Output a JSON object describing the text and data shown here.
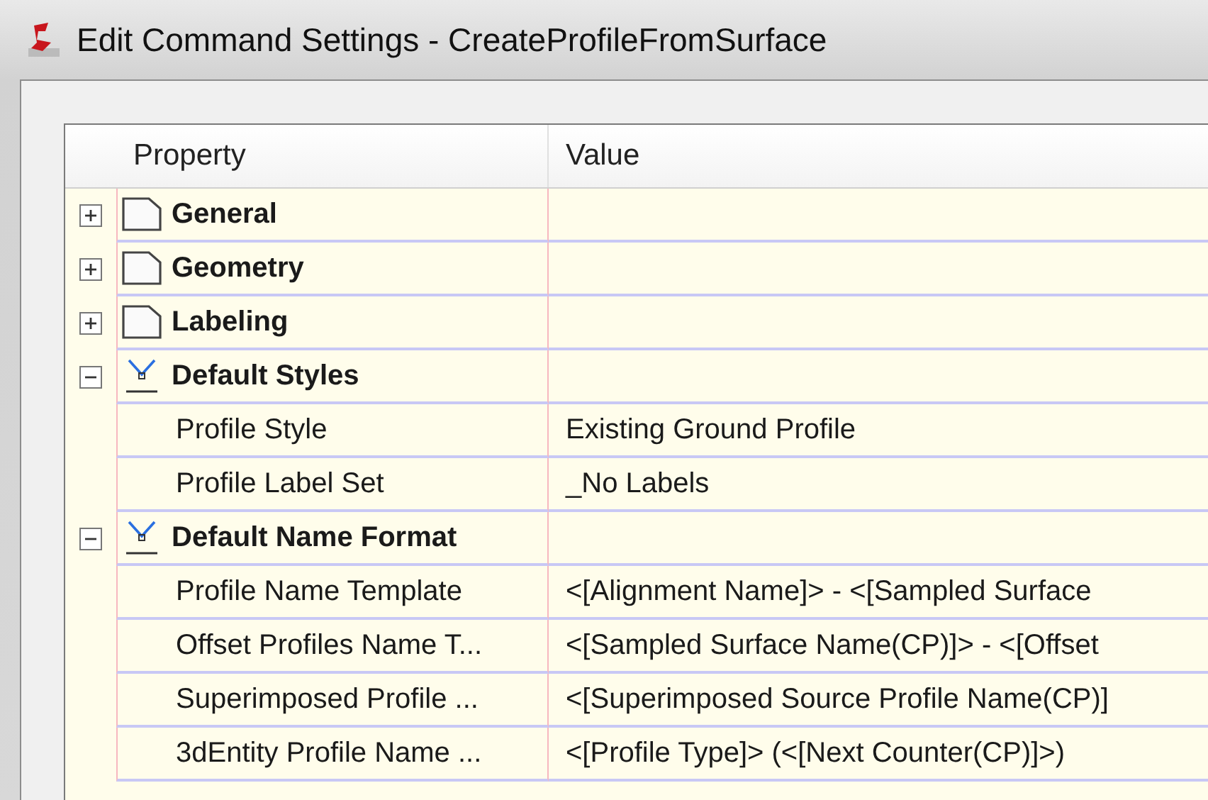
{
  "window": {
    "title": "Edit Command Settings - CreateProfileFromSurface"
  },
  "grid": {
    "columns": [
      "Property",
      "Value"
    ],
    "groups": [
      {
        "label": "General",
        "kind": "page",
        "expanded": false
      },
      {
        "label": "Geometry",
        "kind": "page",
        "expanded": false
      },
      {
        "label": "Labeling",
        "kind": "page",
        "expanded": false
      },
      {
        "label": "Default Styles",
        "kind": "style",
        "expanded": true,
        "rows": [
          {
            "property": "Profile Style",
            "value": "Existing Ground Profile"
          },
          {
            "property": "Profile Label Set",
            "value": "_No Labels"
          }
        ]
      },
      {
        "label": "Default Name Format",
        "kind": "style",
        "expanded": true,
        "rows": [
          {
            "property": "Profile Name Template",
            "value": "<[Alignment Name]> - <[Sampled Surface"
          },
          {
            "property": "Offset Profiles Name T...",
            "value": "<[Sampled Surface Name(CP)]> - <[Offset"
          },
          {
            "property": "Superimposed Profile ...",
            "value": "<[Superimposed Source Profile Name(CP)]"
          },
          {
            "property": "3dEntity Profile Name ...",
            "value": "<[Profile Type]> (<[Next Counter(CP)]>)"
          }
        ]
      }
    ]
  }
}
